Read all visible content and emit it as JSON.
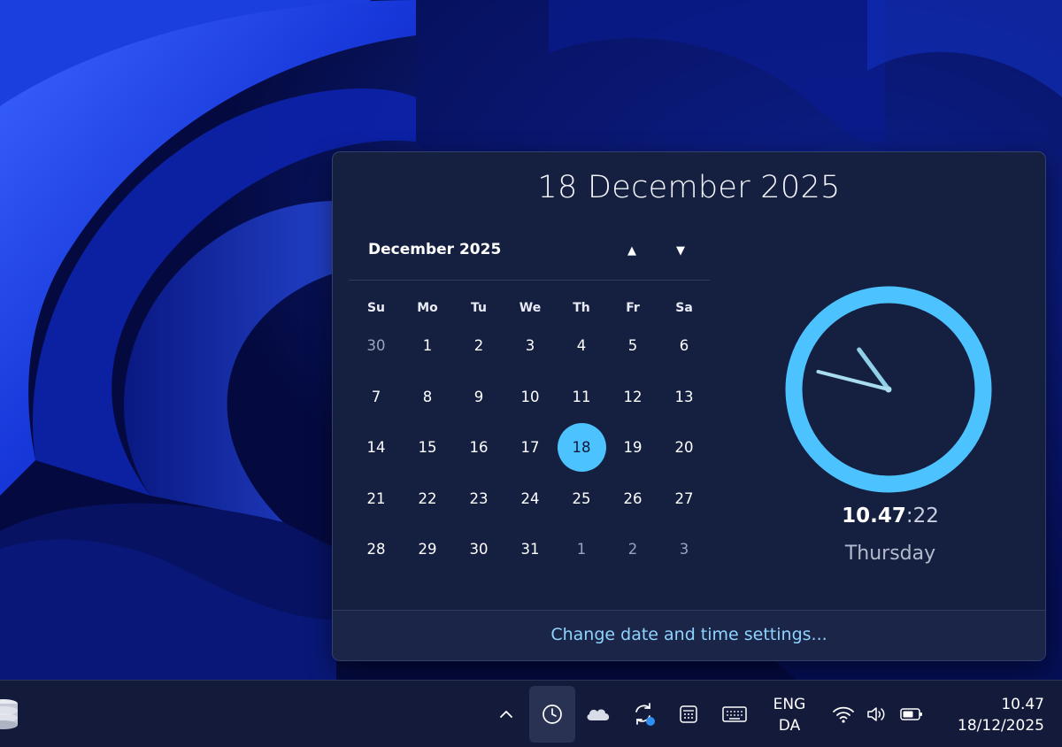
{
  "flyout": {
    "full_date": "18 December 2025",
    "month_label": "December 2025",
    "prev_arrow": "▲",
    "next_arrow": "▼",
    "weekdays": [
      "Su",
      "Mo",
      "Tu",
      "We",
      "Th",
      "Fr",
      "Sa"
    ],
    "days": [
      {
        "d": "30",
        "other": true
      },
      {
        "d": "1"
      },
      {
        "d": "2"
      },
      {
        "d": "3"
      },
      {
        "d": "4"
      },
      {
        "d": "5"
      },
      {
        "d": "6"
      },
      {
        "d": "7"
      },
      {
        "d": "8"
      },
      {
        "d": "9"
      },
      {
        "d": "10"
      },
      {
        "d": "11"
      },
      {
        "d": "12"
      },
      {
        "d": "13"
      },
      {
        "d": "14"
      },
      {
        "d": "15"
      },
      {
        "d": "16"
      },
      {
        "d": "17"
      },
      {
        "d": "18",
        "today": true
      },
      {
        "d": "19"
      },
      {
        "d": "20"
      },
      {
        "d": "21"
      },
      {
        "d": "22"
      },
      {
        "d": "23"
      },
      {
        "d": "24"
      },
      {
        "d": "25"
      },
      {
        "d": "26"
      },
      {
        "d": "27"
      },
      {
        "d": "28"
      },
      {
        "d": "29"
      },
      {
        "d": "30"
      },
      {
        "d": "31"
      },
      {
        "d": "1",
        "other": true
      },
      {
        "d": "2",
        "other": true
      },
      {
        "d": "3",
        "other": true
      }
    ],
    "clock": {
      "hour": 10,
      "minute": 47,
      "second": 22
    },
    "time_hm": "10.47",
    "time_sep": ":",
    "time_sec": "22",
    "weekday_name": "Thursday",
    "settings_link": "Change date and time settings..."
  },
  "taskbar": {
    "language_line1": "ENG",
    "language_line2": "DA",
    "tray_time": "10.47",
    "tray_date": "18/12/2025"
  },
  "colors": {
    "accent": "#4cc2ff",
    "flyout_bg": "#152040",
    "taskbar_bg": "#141b3a",
    "link": "#8fd3ff"
  }
}
